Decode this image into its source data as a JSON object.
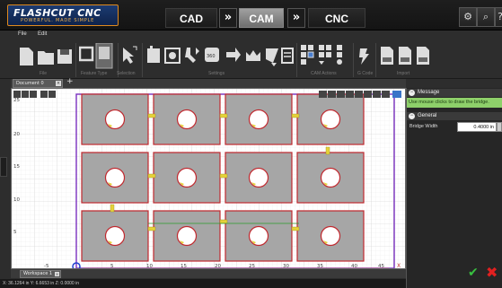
{
  "app": {
    "logo_main": "FLASHCUT CNC",
    "logo_tagline": "POWERFUL. MADE SIMPLE"
  },
  "modes": [
    {
      "label": "CAD",
      "active": false
    },
    {
      "label": "CAM",
      "active": true
    },
    {
      "label": "CNC",
      "active": false
    }
  ],
  "top_icons": [
    "settings-gears-icon",
    "search-icon",
    "help-icon"
  ],
  "menu": [
    "File",
    "Edit"
  ],
  "ribbon_groups": [
    "File",
    "Feature Type",
    "Selection",
    "Settings",
    "CAM Actions",
    "G Code",
    "Import"
  ],
  "document_tab": "Document 0",
  "canvas": {
    "y_ticks": [
      "25",
      "20",
      "15",
      "10",
      "5"
    ],
    "x_ticks": [
      "-5",
      "5",
      "10",
      "15",
      "20",
      "25",
      "30",
      "35",
      "40",
      "45"
    ],
    "x_axis_letter": "X",
    "grid_rows": 3,
    "grid_cols": 4
  },
  "panel": {
    "message_title": "Message",
    "message_text": "Use mouse clicks to draw the bridge.",
    "general_title": "General",
    "bridge_width_label": "Bridge Width",
    "bridge_width_value": "0.4000 in"
  },
  "workspace_tab": "Workspace 1",
  "status_text": "X: 36.1264 in   Y: 6.6653 in   Z: 0.0000 in",
  "colors": {
    "accent_orange": "#e08a1e",
    "part_outline": "#c0282e",
    "part_fill": "#a6a6a6",
    "message_green": "#8ed06a",
    "bridge_yellow": "#e6d23a",
    "axis_purple": "#7a30c0"
  }
}
